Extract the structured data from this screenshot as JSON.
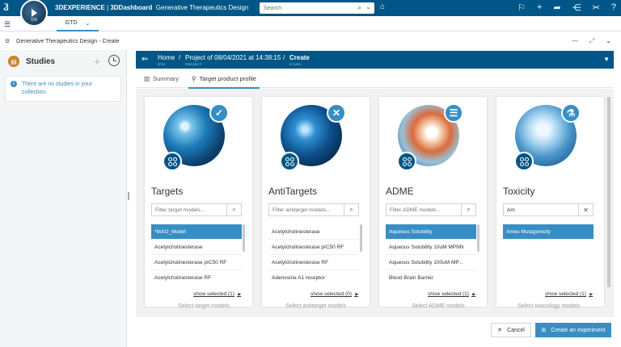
{
  "topbar": {
    "brand": "3DEXPERIENCE",
    "dashboard": "3DDashboard",
    "app_name": "Generative Therapeutics Design",
    "compass_label": "3D",
    "compass_version": "V,R",
    "search_placeholder": "Search",
    "bg_color": "#005686"
  },
  "tabbar": {
    "active_tab": "GTD"
  },
  "app_header": {
    "title": "Generative Therapeutics Design - Create"
  },
  "studies": {
    "title": "Studies",
    "empty_message": "There are no studies in your collection."
  },
  "breadcrumb": {
    "items": [
      {
        "title": "Home",
        "sub": "GTD"
      },
      {
        "title": "Project of 08/04/2021 at 14:38:15",
        "sub": "PROJECT"
      },
      {
        "title": "Create",
        "sub": "STUDY"
      }
    ],
    "separator": "/"
  },
  "subtabs": [
    {
      "label": "Summary",
      "active": false
    },
    {
      "label": "Target product profile",
      "active": true
    }
  ],
  "cards": [
    {
      "name": "Targets",
      "badge": "✓",
      "filter_placeholder": "Filter target models...",
      "filter_value": "",
      "items": [
        {
          "label": "*MAO_Model",
          "selected": true
        },
        {
          "label": "Acetylcholinesterase",
          "selected": false
        },
        {
          "label": "Acetylcholinesterase pIC50 RF",
          "selected": false
        },
        {
          "label": "Acetylcholinesterase RF",
          "selected": false
        }
      ],
      "show_selected": "show selected (1)",
      "select_hint": "Select target models"
    },
    {
      "name": "AntiTargets",
      "badge": "✕",
      "filter_placeholder": "Filter antitarget models...",
      "filter_value": "",
      "items": [
        {
          "label": "Acetylcholinesterase",
          "selected": false
        },
        {
          "label": "Acetylcholinesterase pIC50 RF",
          "selected": false
        },
        {
          "label": "Acetylcholinesterase RF",
          "selected": false
        },
        {
          "label": "Adenosine A1 receptor",
          "selected": false
        }
      ],
      "show_selected": "show selected (0)",
      "select_hint": "Select antitarget models"
    },
    {
      "name": "ADME",
      "badge": "☰",
      "filter_placeholder": "Filter ADME models...",
      "filter_value": "",
      "items": [
        {
          "label": "Aqueous Solubility",
          "selected": true
        },
        {
          "label": "Aqueous Solubility 10uM MPNN",
          "selected": false
        },
        {
          "label": "Aqueous Solubility 100uM MP...",
          "selected": false
        },
        {
          "label": "Blood Brain Barrier",
          "selected": false
        }
      ],
      "show_selected": "show selected (1)",
      "select_hint": "Select ADME models"
    },
    {
      "name": "Toxicity",
      "badge": "⚗",
      "filter_placeholder": "",
      "filter_value": "Am",
      "items": [
        {
          "label": "Ames Mutagenicity",
          "selected": true
        }
      ],
      "show_selected": "show selected (1)",
      "select_hint": "Select toxicology models"
    }
  ],
  "footer": {
    "cancel_label": "Cancel",
    "create_label": "Create an experiment",
    "accent_color": "#368ec4"
  }
}
